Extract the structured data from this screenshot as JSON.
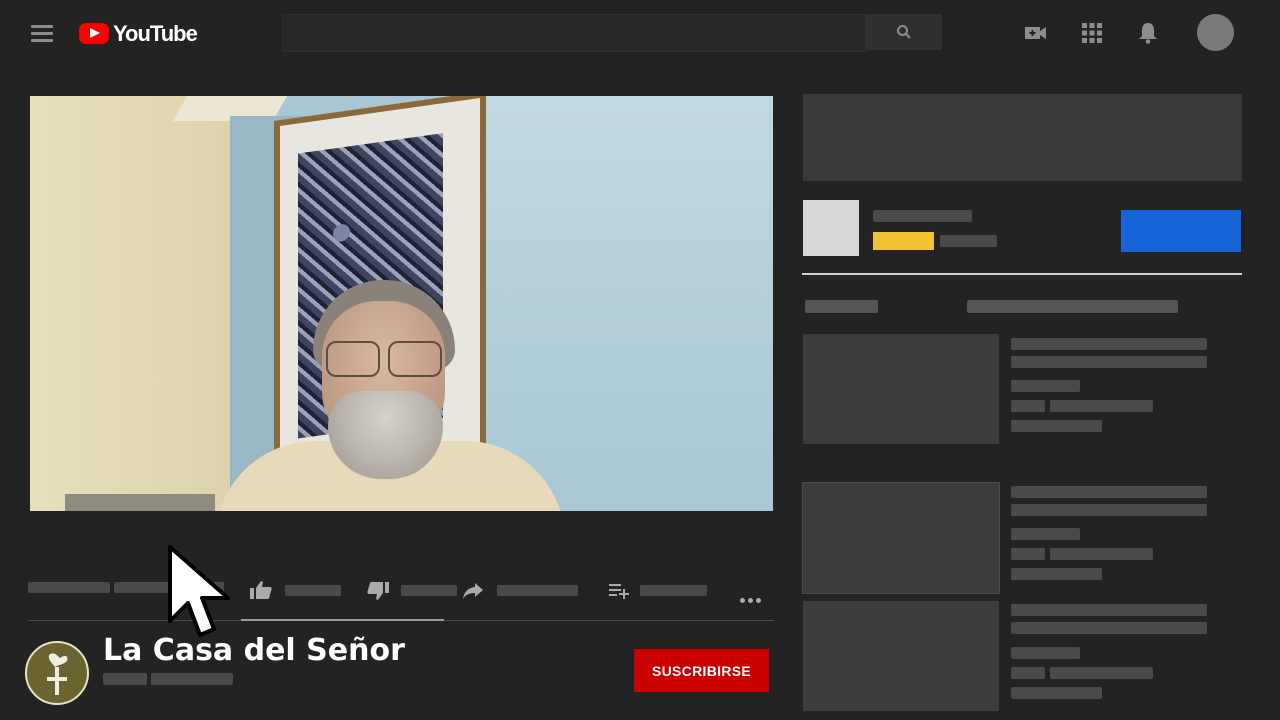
{
  "header": {
    "logo_text": "YouTube",
    "icons": [
      "menu-icon",
      "search-icon",
      "video-create-icon",
      "apps-icon",
      "notifications-icon",
      "avatar"
    ]
  },
  "video": {
    "description": "Man with beard and glasses sitting in front of blue wall with framed artwork"
  },
  "channel": {
    "name": "La Casa del Señor",
    "subscribe_label": "SUSCRIBIRSE"
  },
  "colors": {
    "background": "#232323",
    "placeholder": "#4a4a4a",
    "subscribe": "#cc0000",
    "accent_blue": "#1565d8",
    "accent_yellow": "#f1c232"
  }
}
